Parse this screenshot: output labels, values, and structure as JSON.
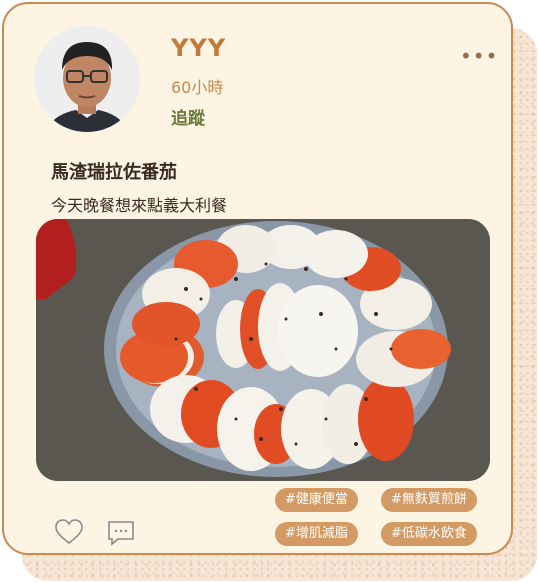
{
  "post": {
    "username": "YYY",
    "time": "60小時",
    "follow_label": "追蹤",
    "more_label": "•••",
    "title": "馬渣瑞拉佐番茄",
    "description": "今天晚餐想來點義大利餐",
    "tags": [
      "#健康便當",
      "#無麩質煎餅",
      "#增肌減脂",
      "#低碳水飲食"
    ]
  },
  "icons": {
    "like": "heart-icon",
    "comment": "comment-icon",
    "more": "more-icon"
  },
  "colors": {
    "accent": "#c27a38",
    "follow": "#6a7a3c",
    "tag_bg": "#d49a63",
    "card_bg": "#fdf4e4",
    "border": "#c98a4e"
  }
}
